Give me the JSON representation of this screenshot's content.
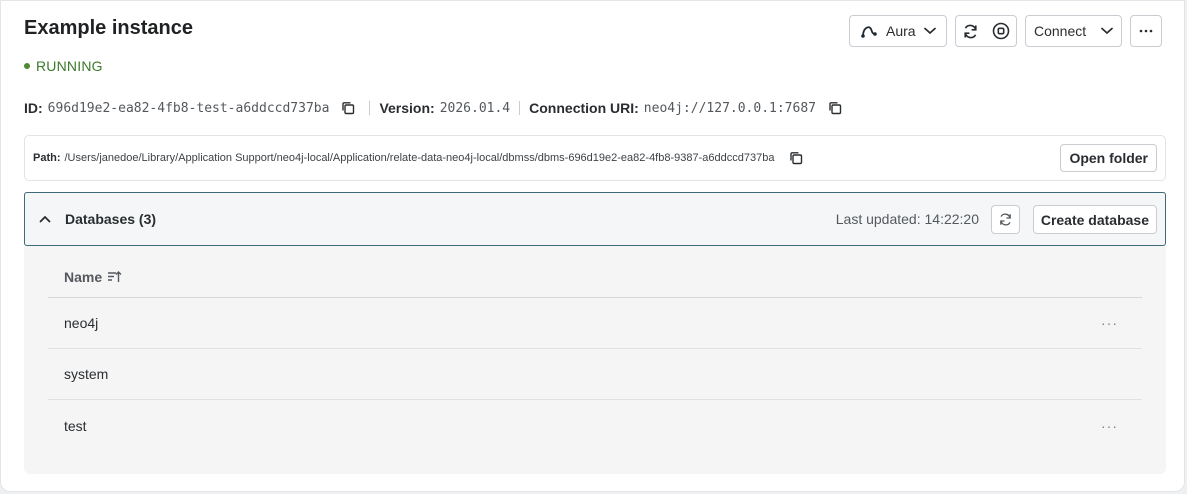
{
  "instance": {
    "title": "Example instance",
    "status": "RUNNING",
    "status_color": "#4d8a2f"
  },
  "toolbar": {
    "aura_label": "Aura",
    "connect_label": "Connect"
  },
  "meta": {
    "id_label": "ID:",
    "id_value": "696d19e2-ea82-4fb8-test-a6ddccd737ba",
    "version_label": "Version:",
    "version_value": "2026.01.4",
    "uri_label": "Connection URI:",
    "uri_value": "neo4j://127.0.0.1:7687"
  },
  "path": {
    "label": "Path:",
    "value": "/Users/janedoe/Library/Application Support/neo4j-local/Application/relate-data-neo4j-local/dbmss/dbms-696d19e2-ea82-4fb8-9387-a6ddccd737ba",
    "open_folder_label": "Open folder"
  },
  "databases": {
    "title": "Databases (3)",
    "last_updated_label": "Last updated:",
    "last_updated_value": "14:22:20",
    "create_label": "Create database",
    "column_name": "Name",
    "rows": [
      {
        "name": "neo4j",
        "has_menu": true
      },
      {
        "name": "system",
        "has_menu": false
      },
      {
        "name": "test",
        "has_menu": true
      }
    ],
    "header_border_color": "#3f6a7a"
  },
  "icons": {
    "aura": "aura-icon",
    "chevron": "chevron-down-icon",
    "refresh": "refresh-icon",
    "stop": "stop-icon",
    "more": "more-horizontal-icon",
    "copy": "copy-icon",
    "collapse": "chevron-up-icon",
    "sort": "sort-icon"
  },
  "row_menu_glyph": "···"
}
